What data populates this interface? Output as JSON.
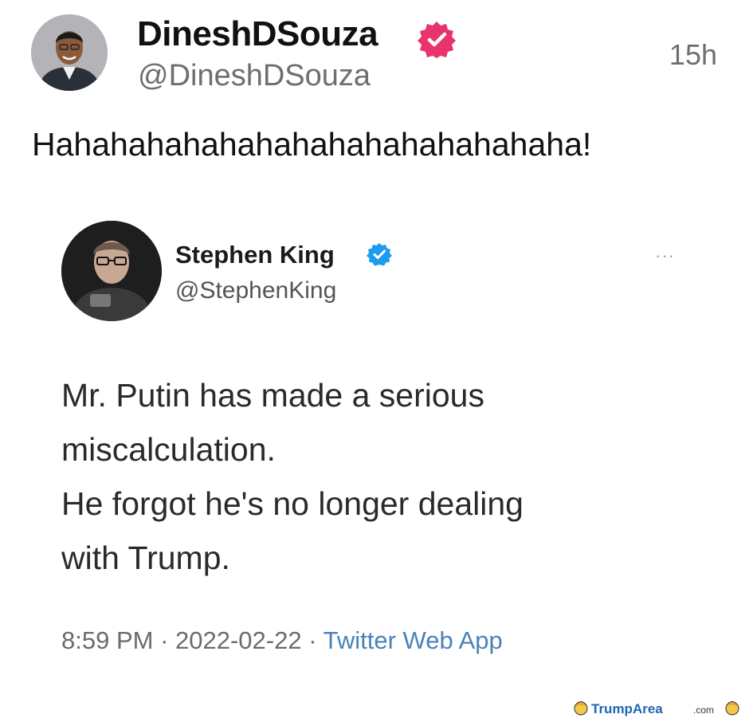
{
  "outer_post": {
    "display_name": "DineshDSouza",
    "handle": "@DineshDSouza",
    "time_ago": "15h",
    "text": "Hahahahahahahahahahahahahahaha!",
    "badge_color": "#e8336c"
  },
  "quoted_tweet": {
    "display_name": "Stephen King",
    "handle": "@StephenKing",
    "lines": [
      "Mr. Putin has made a serious",
      "miscalculation.",
      "He forgot he's no longer dealing",
      "with Trump."
    ],
    "time": "8:59 PM",
    "date": "2022-02-22",
    "source": "Twitter Web App",
    "more_label": "···",
    "badge_color": "#1d9bf0"
  },
  "watermark": {
    "text_main": "TrumpArea",
    "text_suffix": ".com"
  }
}
